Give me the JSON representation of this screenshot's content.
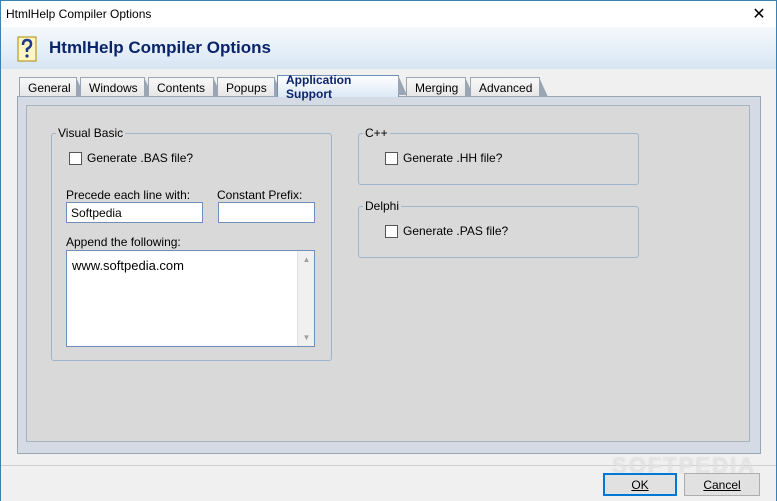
{
  "window": {
    "title": "HtmlHelp Compiler Options"
  },
  "header": {
    "title": "HtmlHelp Compiler Options",
    "icon": "help-question-icon"
  },
  "tabs": [
    {
      "label": "General"
    },
    {
      "label": "Windows"
    },
    {
      "label": "Contents"
    },
    {
      "label": "Popups"
    },
    {
      "label": "Application Support",
      "active": true
    },
    {
      "label": "Merging"
    },
    {
      "label": "Advanced"
    }
  ],
  "visual_basic": {
    "legend": "Visual Basic",
    "generate_bas_label": "Generate .BAS file?",
    "generate_bas_checked": false,
    "precede_label": "Precede each line with:",
    "precede_value": "Softpedia",
    "constant_prefix_label": "Constant Prefix:",
    "constant_prefix_value": "",
    "append_label": "Append the following:",
    "append_value": "www.softpedia.com"
  },
  "cpp": {
    "legend": "C++",
    "generate_hh_label": "Generate .HH file?",
    "generate_hh_checked": false
  },
  "delphi": {
    "legend": "Delphi",
    "generate_pas_label": "Generate .PAS file?",
    "generate_pas_checked": false
  },
  "buttons": {
    "ok": "OK",
    "cancel": "Cancel"
  },
  "watermark": "SOFTPEDIA",
  "colors": {
    "header_title": "#0a246a",
    "border_accent": "#6f8fb6"
  }
}
